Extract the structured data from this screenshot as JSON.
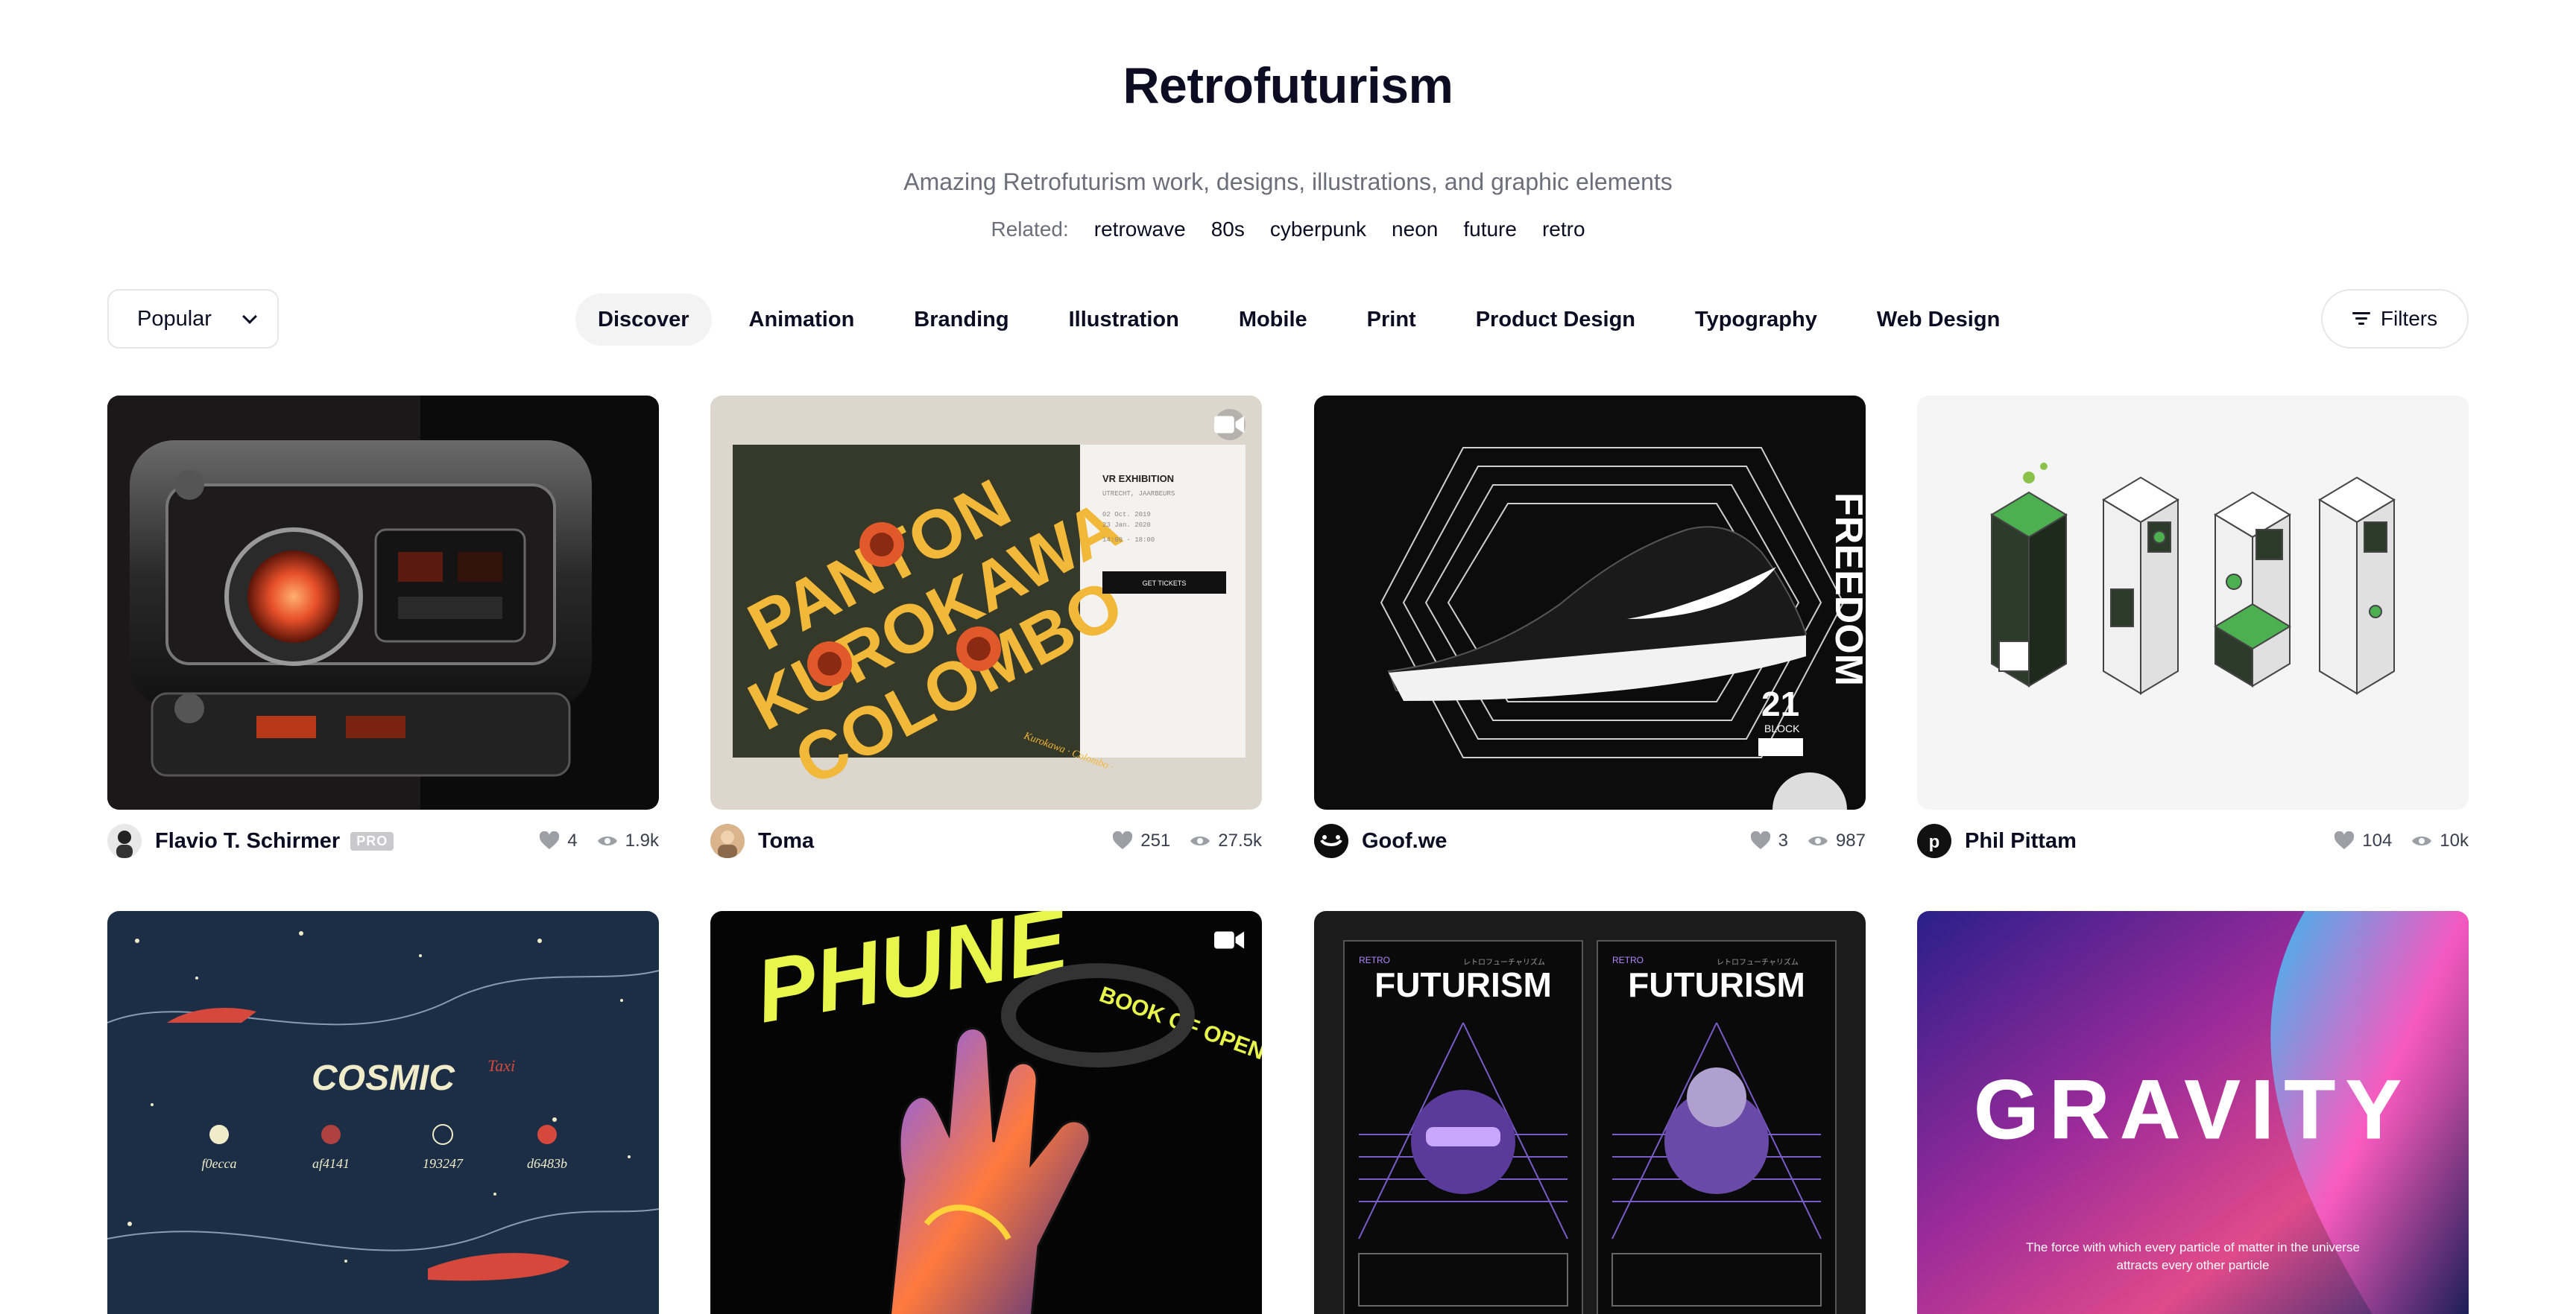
{
  "hero": {
    "title": "Retrofuturism",
    "subtitle": "Amazing Retrofuturism work, designs, illustrations, and graphic elements",
    "related_label": "Related:",
    "related_tags": [
      "retrowave",
      "80s",
      "cyberpunk",
      "neon",
      "future",
      "retro"
    ]
  },
  "filterbar": {
    "sort_value": "Popular",
    "categories": [
      "Discover",
      "Animation",
      "Branding",
      "Illustration",
      "Mobile",
      "Print",
      "Product Design",
      "Typography",
      "Web Design"
    ],
    "active_category": "Discover",
    "filters_label": "Filters"
  },
  "shots": [
    {
      "author": "Flavio T. Schirmer",
      "pro": "PRO",
      "likes": "4",
      "views": "1.9k"
    },
    {
      "author": "Toma",
      "likes": "251",
      "views": "27.5k",
      "thumb_text": {
        "big": [
          "PANTON",
          "KUROKAWA",
          "COLOMBO"
        ],
        "heading": "VR EXHIBITION",
        "city": "UTRECHT, JAARBEURS",
        "date1": "02 Oct. 2019",
        "date2": "23 Jan. 2020",
        "hours": "14:00 - 18:00",
        "button": "GET TICKETS",
        "circle": "Kurokawa · Colombo ·"
      }
    },
    {
      "author": "Goof.we",
      "likes": "3",
      "views": "987",
      "thumb_text": {
        "vertical": "FREEDOM",
        "block": "21",
        "block_label": "BLOCK"
      }
    },
    {
      "author": "Phil Pittam",
      "likes": "104",
      "views": "10k"
    },
    {
      "thumb_text": {
        "word": "COSMIC",
        "sub": "Taxi",
        "swatches": [
          "f0ecca",
          "af4141",
          "193247",
          "d6483b"
        ]
      }
    },
    {
      "thumb_text": {
        "word": "PHUNE",
        "ring": "BOOK OF OPEN"
      }
    },
    {
      "thumb_text": {
        "small": "RETRO",
        "word": "FUTURISM",
        "jp": "レトロフューチャリズム"
      }
    },
    {
      "thumb_text": {
        "word": "GRAVITY",
        "caption": "The force with which every particle of matter in the universe attracts every other particle"
      }
    }
  ],
  "colors": {
    "accent": "#0d0c22",
    "muted": "#6e6d7a",
    "border": "#e7e7e9",
    "active_bg": "#f3f3f4"
  }
}
